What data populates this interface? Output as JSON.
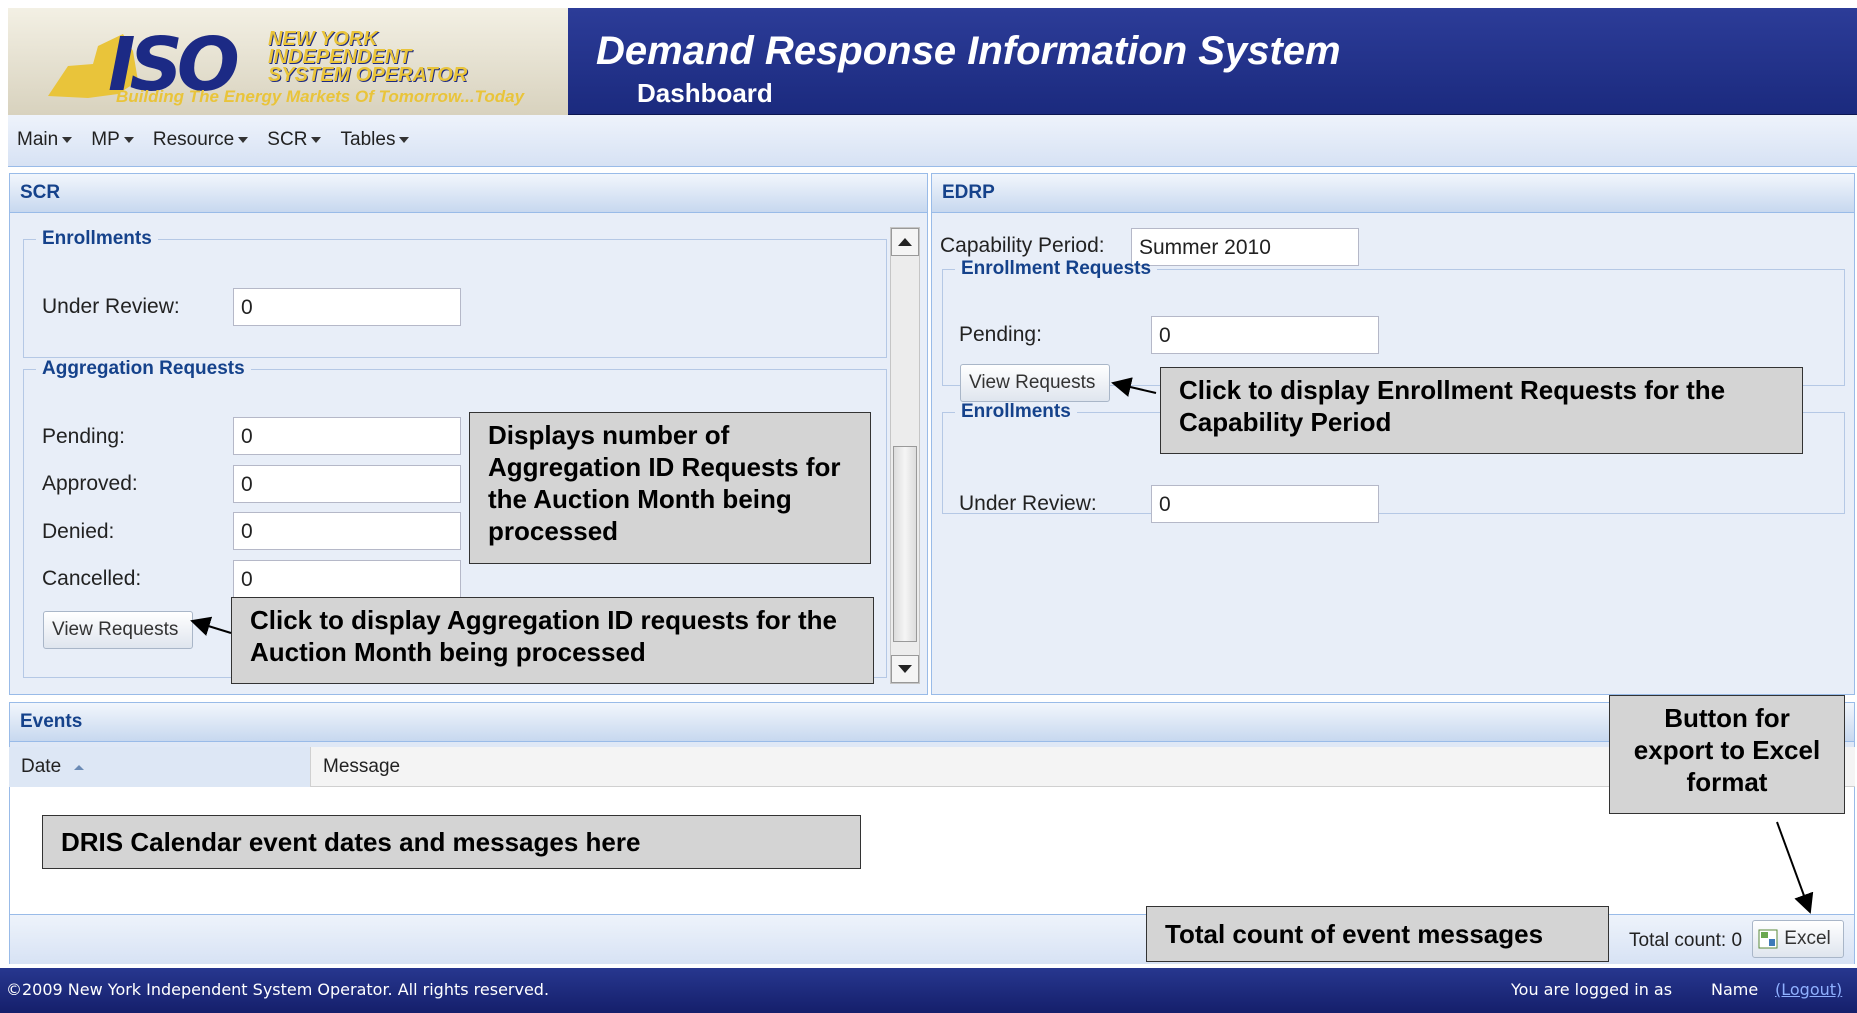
{
  "header": {
    "logo_top": "NEW YORK",
    "logo_mid": "INDEPENDENT",
    "logo_bot": "SYSTEM OPERATOR",
    "logo_mark": "ISO",
    "logo_tagline": "Building The Energy Markets Of Tomorrow...Today",
    "app_title": "Demand Response Information System",
    "page_title": "Dashboard"
  },
  "menu": [
    {
      "label": "Main"
    },
    {
      "label": "MP"
    },
    {
      "label": "Resource"
    },
    {
      "label": "SCR"
    },
    {
      "label": "Tables"
    }
  ],
  "scr": {
    "title": "SCR",
    "enrollments": {
      "legend": "Enrollments",
      "under_review_label": "Under Review:",
      "under_review_value": "0"
    },
    "aggregation": {
      "legend": "Aggregation Requests",
      "pending_label": "Pending:",
      "pending_value": "0",
      "approved_label": "Approved:",
      "approved_value": "0",
      "denied_label": "Denied:",
      "denied_value": "0",
      "cancelled_label": "Cancelled:",
      "cancelled_value": "0",
      "view_button": "View Requests"
    }
  },
  "edrp": {
    "title": "EDRP",
    "capability_label": "Capability Period:",
    "capability_value": "Summer 2010",
    "enrollment_requests": {
      "legend": "Enrollment Requests",
      "pending_label": "Pending:",
      "pending_value": "0",
      "view_button": "View Requests"
    },
    "enrollments": {
      "legend": "Enrollments",
      "under_review_label": "Under Review:",
      "under_review_value": "0"
    }
  },
  "events": {
    "title": "Events",
    "col_date": "Date",
    "col_message": "Message",
    "total_count": "Total count: 0",
    "excel_button": "Excel"
  },
  "callouts": {
    "aggregation_count": "Displays number of Aggregation ID Requests for the Auction Month being processed",
    "aggregation_view": "Click to display Aggregation ID requests for the Auction Month being processed",
    "edrp_view": "Click to display Enrollment Requests for the Capability Period",
    "excel": "Button for export to Excel format",
    "calendar": "DRIS Calendar event dates and messages here",
    "total": "Total count of event messages"
  },
  "footer": {
    "copyright": "©2009   New York Independent System Operator. All rights reserved.",
    "logged_in": "You are logged in as",
    "user": "Name",
    "logout": "(Logout)"
  },
  "colors": {
    "header_bg": "#1b2a7e",
    "panel_title": "#15428b",
    "panel_bg": "#dfe8f6",
    "logo_yellow": "#e9c43a"
  }
}
